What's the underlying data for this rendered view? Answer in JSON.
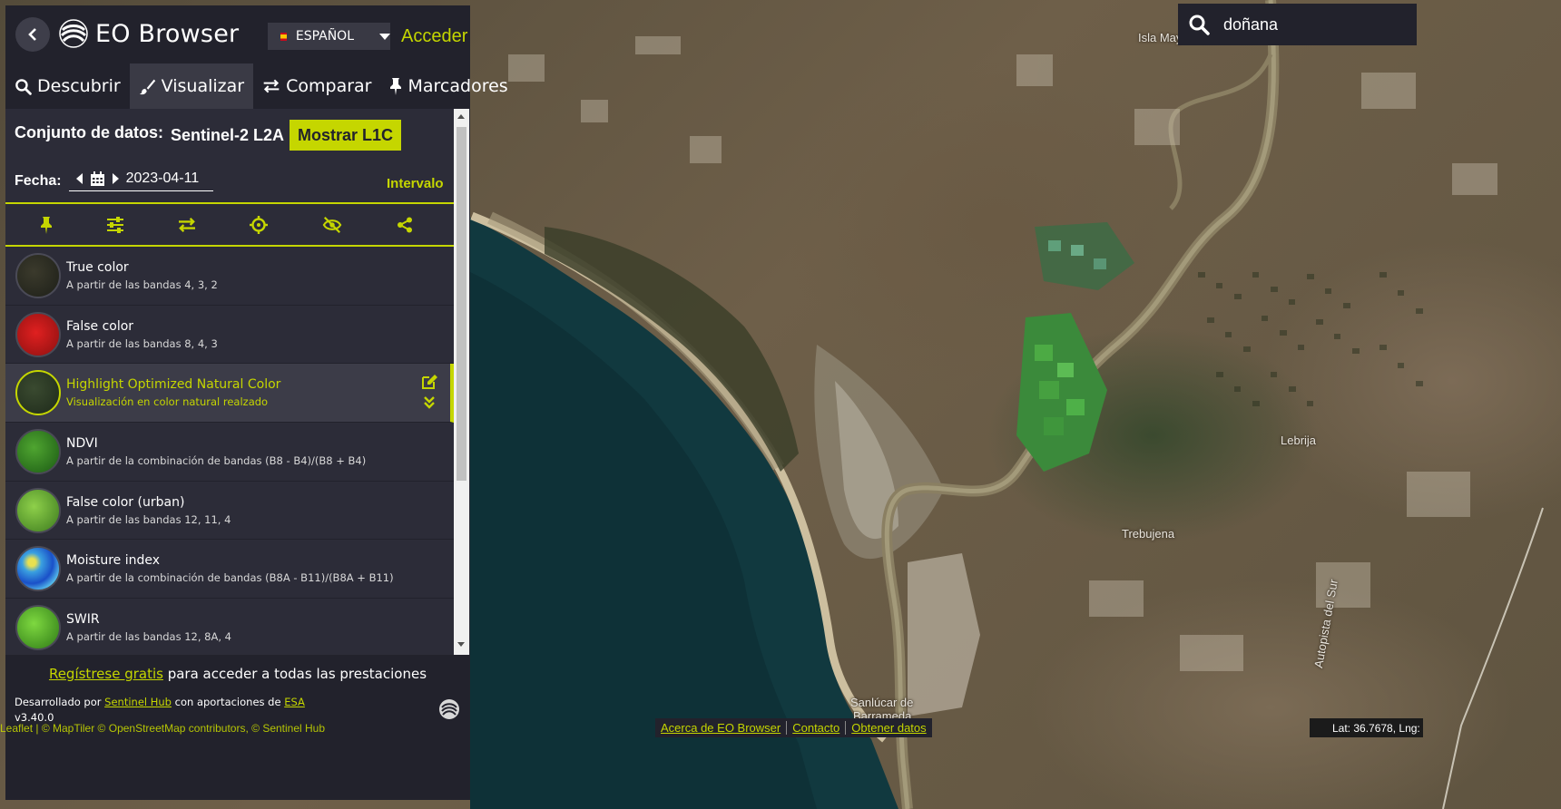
{
  "app": {
    "title": "EO Browser",
    "language": "ESPAÑOL",
    "login_label": "Acceder"
  },
  "tabs": [
    {
      "label": "Descubrir",
      "icon": "search-icon"
    },
    {
      "label": "Visualizar",
      "icon": "brush-icon",
      "active": true
    },
    {
      "label": "Comparar",
      "icon": "swap-icon"
    },
    {
      "label": "Marcadores",
      "icon": "pin-icon"
    }
  ],
  "dataset": {
    "label": "Conjunto de datos:",
    "value": "Sentinel-2 L2A",
    "toggle_button": "Mostrar L1C"
  },
  "date": {
    "label": "Fecha:",
    "value": "2023-04-11",
    "interval_label": "Intervalo"
  },
  "toolbar_icons": [
    "pin-icon",
    "sliders-icon",
    "compare-icon",
    "crosshair-icon",
    "eye-slash-icon",
    "share-icon"
  ],
  "layers": [
    {
      "title": "True color",
      "desc": "A partir de las bandas 4, 3, 2"
    },
    {
      "title": "False color",
      "desc": "A partir de las bandas 8, 4, 3"
    },
    {
      "title": "Highlight Optimized Natural Color",
      "desc": "Visualización en color natural realzado",
      "active": true
    },
    {
      "title": "NDVI",
      "desc": "A partir de la combinación de bandas (B8 - B4)/(B8 + B4)"
    },
    {
      "title": "False color (urban)",
      "desc": "A partir de las bandas 12, 11, 4"
    },
    {
      "title": "Moisture index",
      "desc": "A partir de la combinación de bandas (B8A - B11)/(B8A + B11)"
    },
    {
      "title": "SWIR",
      "desc": "A partir de las bandas 12, 8A, 4"
    }
  ],
  "footer": {
    "signup_link": "Regístrese gratis",
    "signup_rest": " para acceder a todas las prestaciones",
    "credits_prefix": "Desarrollado por ",
    "credits_link1": "Sentinel Hub",
    "credits_mid": " con aportaciones de ",
    "credits_link2": "ESA",
    "version": "v3.40.0"
  },
  "search": {
    "value": "doñana"
  },
  "map": {
    "labels": {
      "isla": "Isla May",
      "lebrija": "Lebrija",
      "trebujena": "Trebujena",
      "sanlucar1": "Sanlúcar de",
      "sanlucar2": "Barrameda",
      "autopista": "Autopista del Sur"
    },
    "attribution": "Leaflet | © MapTiler © OpenStreetMap contributors, © Sentinel Hub",
    "bottom_links": [
      "Acerca de EO Browser",
      "Contacto",
      "Obtener datos"
    ],
    "latlng": "Lat: 36.7678, Lng: -"
  },
  "colors": {
    "accent": "#c5d600",
    "panel": "#22222c",
    "panel_content": "#2c2c38"
  }
}
